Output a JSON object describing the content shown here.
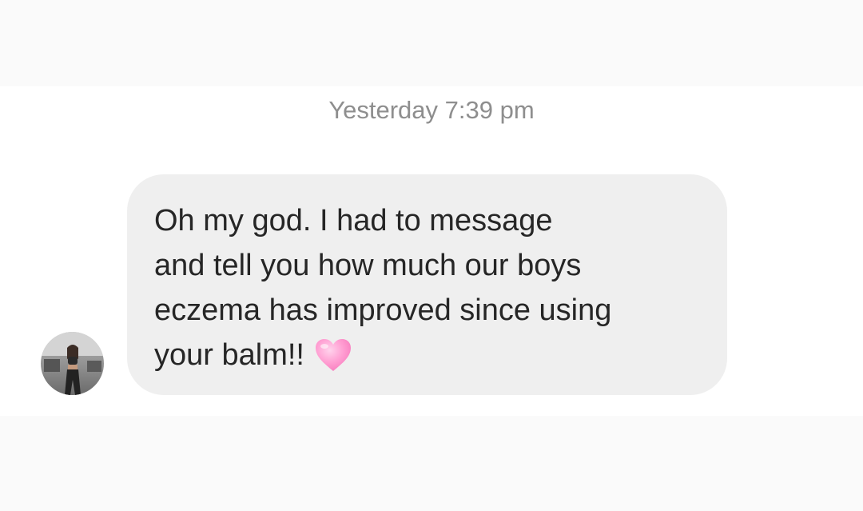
{
  "thread": {
    "timestamp": "Yesterday 7:39 pm"
  },
  "message": {
    "text": "Oh my god. I had to message\nand tell you how much our boys\neczema has improved since using\nyour balm!!",
    "emoji": "pink-heart-icon"
  },
  "sender": {
    "avatar": "profile-photo"
  },
  "colors": {
    "bubble": "#efefef",
    "text": "#262626",
    "timestamp": "#8e8e8e",
    "heart": "#ff9ed2"
  }
}
